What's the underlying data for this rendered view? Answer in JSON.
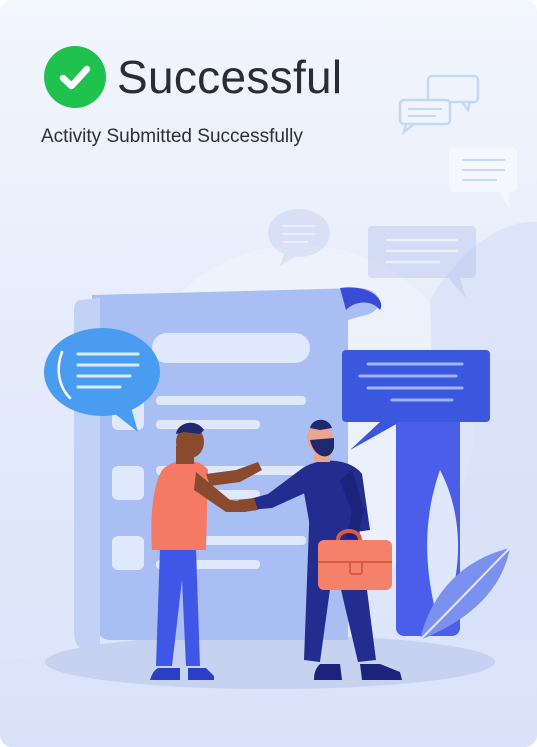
{
  "status": {
    "title": "Successful",
    "message": "Activity Submitted Successfully",
    "icon": "check-circle-icon",
    "accent_color": "#1fc14f"
  },
  "illustration": {
    "name": "handshake-document-illustration"
  }
}
